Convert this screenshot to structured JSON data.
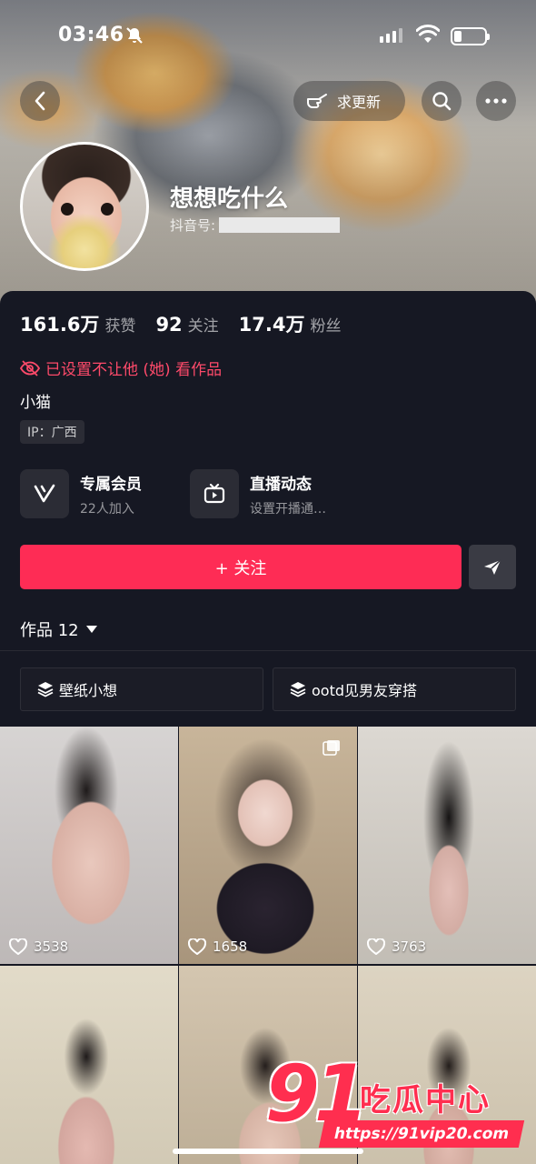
{
  "status_bar": {
    "time": "03:46",
    "battery_level": 0.25
  },
  "header": {
    "update_button_label": "求更新"
  },
  "profile": {
    "nickname": "想想吃什么",
    "douyin_id_label": "抖音号:",
    "stats": [
      {
        "value": "161.6万",
        "label": "获赞"
      },
      {
        "value": "92",
        "label": "关注"
      },
      {
        "value": "17.4万",
        "label": "粉丝"
      }
    ],
    "privacy_notice": "已设置不让他 (她) 看作品",
    "bio": "小猫",
    "ip_tag": "IP：广西"
  },
  "features": [
    {
      "title": "专属会员",
      "subtitle": "22人加入",
      "icon": "v-membership-icon"
    },
    {
      "title": "直播动态",
      "subtitle": "设置开播通…",
      "icon": "live-tv-icon"
    }
  ],
  "actions": {
    "follow_label": "+ 关注"
  },
  "works": {
    "tab_label": "作品 12",
    "collections": [
      {
        "label": "壁纸小想"
      },
      {
        "label": "ootd见男友穿搭"
      }
    ],
    "videos": [
      {
        "likes": "3538"
      },
      {
        "likes": "1658"
      },
      {
        "likes": "3763"
      },
      {
        "likes": ""
      },
      {
        "likes": ""
      },
      {
        "likes": ""
      }
    ]
  },
  "watermark": {
    "logo_number": "91",
    "logo_text": "吃瓜中心",
    "url": "https://91vip20.com"
  },
  "colors": {
    "accent": "#fe2c55",
    "privacy_red": "#fe4a6a",
    "background": "#161823"
  }
}
